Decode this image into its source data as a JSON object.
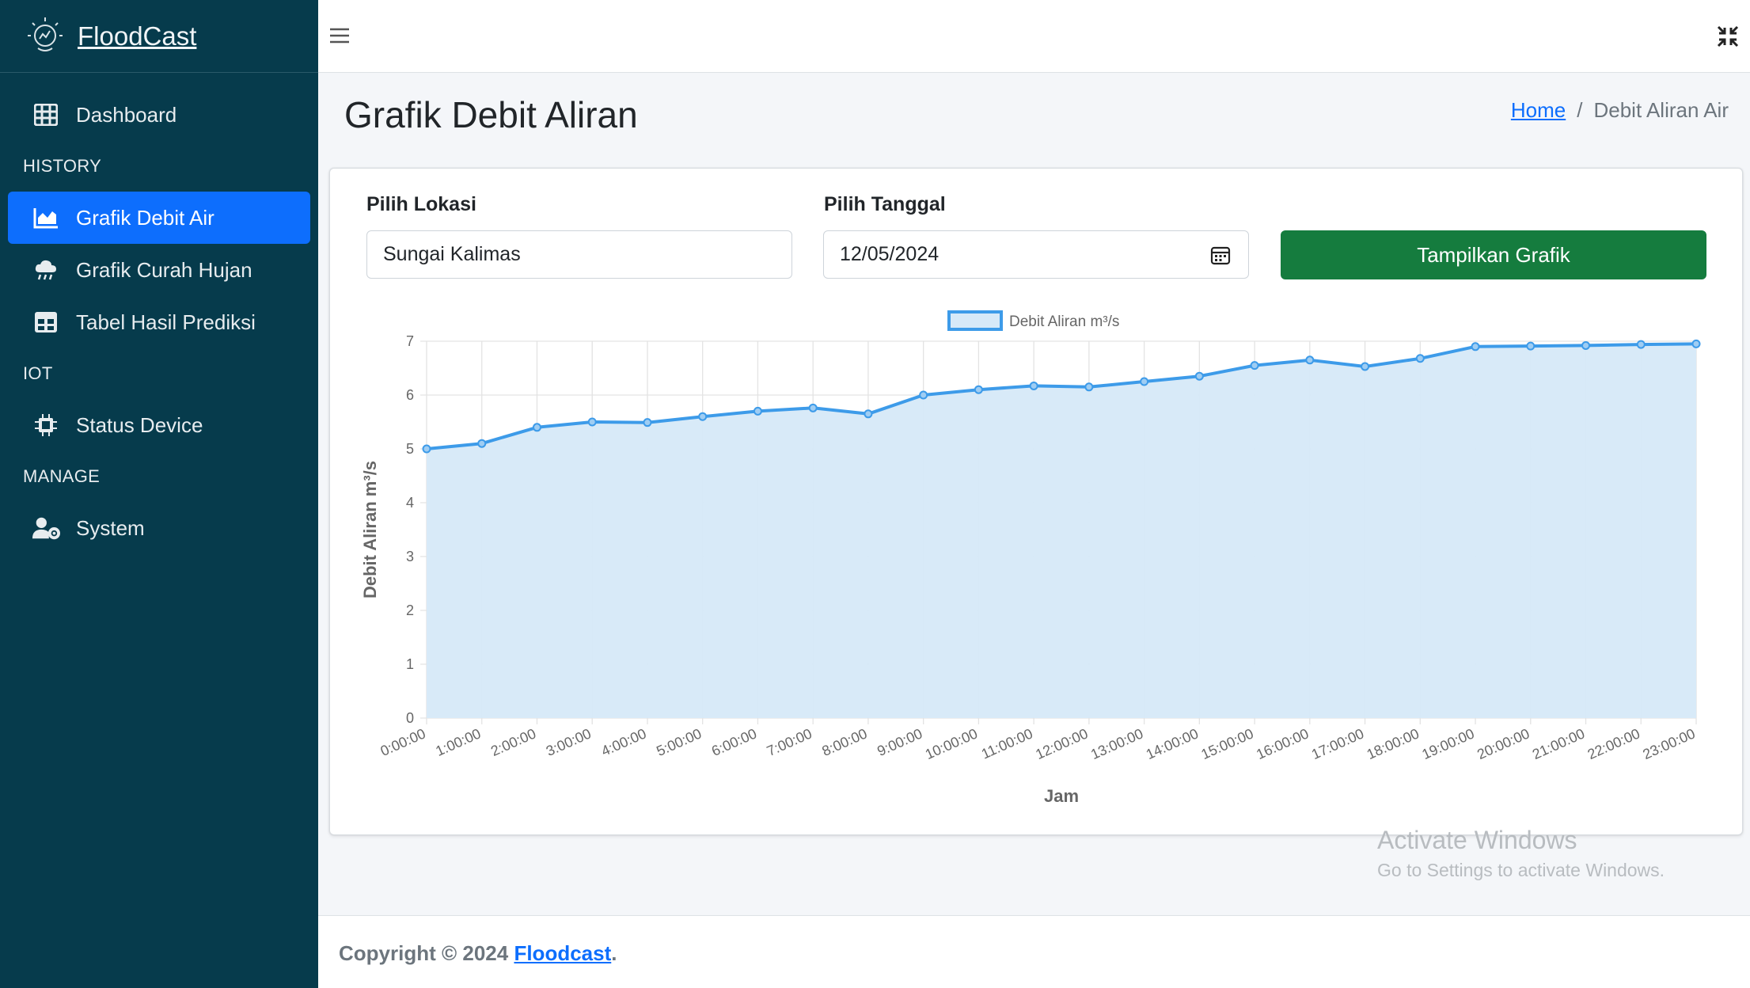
{
  "brand": {
    "name": "FloodCast"
  },
  "sidebar": {
    "dashboard": "Dashboard",
    "sections": {
      "history": "HISTORY",
      "iot": "IOT",
      "manage": "MANAGE"
    },
    "items": {
      "grafik_debit_air": "Grafik Debit Air",
      "grafik_curah_hujan": "Grafik Curah Hujan",
      "tabel_hasil_prediksi": "Tabel Hasil Prediksi",
      "status_device": "Status Device",
      "system": "System"
    },
    "active_color": "#0d6efd",
    "background_color": "#063b4c"
  },
  "page": {
    "title": "Grafik Debit Aliran",
    "breadcrumb": {
      "home": "Home",
      "separator": "/",
      "current": "Debit Aliran Air"
    }
  },
  "form": {
    "location_label": "Pilih Lokasi",
    "location_value": "Sungai Kalimas",
    "date_label": "Pilih Tanggal",
    "date_value": "12/05/2024",
    "submit_label": "Tampilkan Grafik",
    "submit_color": "#157c3e"
  },
  "chart_data": {
    "type": "area",
    "legend": "Debit Aliran m³/s",
    "legend_position": "top-center",
    "xlabel": "Jam",
    "ylabel": "Debit Aliran m³/s",
    "ylim": [
      0,
      7
    ],
    "yticks": [
      0,
      1,
      2,
      3,
      4,
      5,
      6,
      7
    ],
    "grid": true,
    "line_color": "#3d9be9",
    "fill_color": "#d6e9f8",
    "categories": [
      "0:00:00",
      "1:00:00",
      "2:00:00",
      "3:00:00",
      "4:00:00",
      "5:00:00",
      "6:00:00",
      "7:00:00",
      "8:00:00",
      "9:00:00",
      "10:00:00",
      "11:00:00",
      "12:00:00",
      "13:00:00",
      "14:00:00",
      "15:00:00",
      "16:00:00",
      "17:00:00",
      "18:00:00",
      "19:00:00",
      "20:00:00",
      "21:00:00",
      "22:00:00",
      "23:00:00"
    ],
    "values": [
      5.0,
      5.1,
      5.4,
      5.5,
      5.49,
      5.6,
      5.7,
      5.76,
      5.65,
      6.0,
      6.1,
      6.17,
      6.15,
      6.25,
      6.35,
      6.55,
      6.65,
      6.53,
      6.68,
      6.9,
      6.91,
      6.92,
      6.94,
      6.95
    ]
  },
  "footer": {
    "prefix": "Copyright © 2024",
    "link": "Floodcast",
    "suffix": "."
  },
  "watermark": {
    "line1": "Activate Windows",
    "line2": "Go to Settings to activate Windows."
  }
}
